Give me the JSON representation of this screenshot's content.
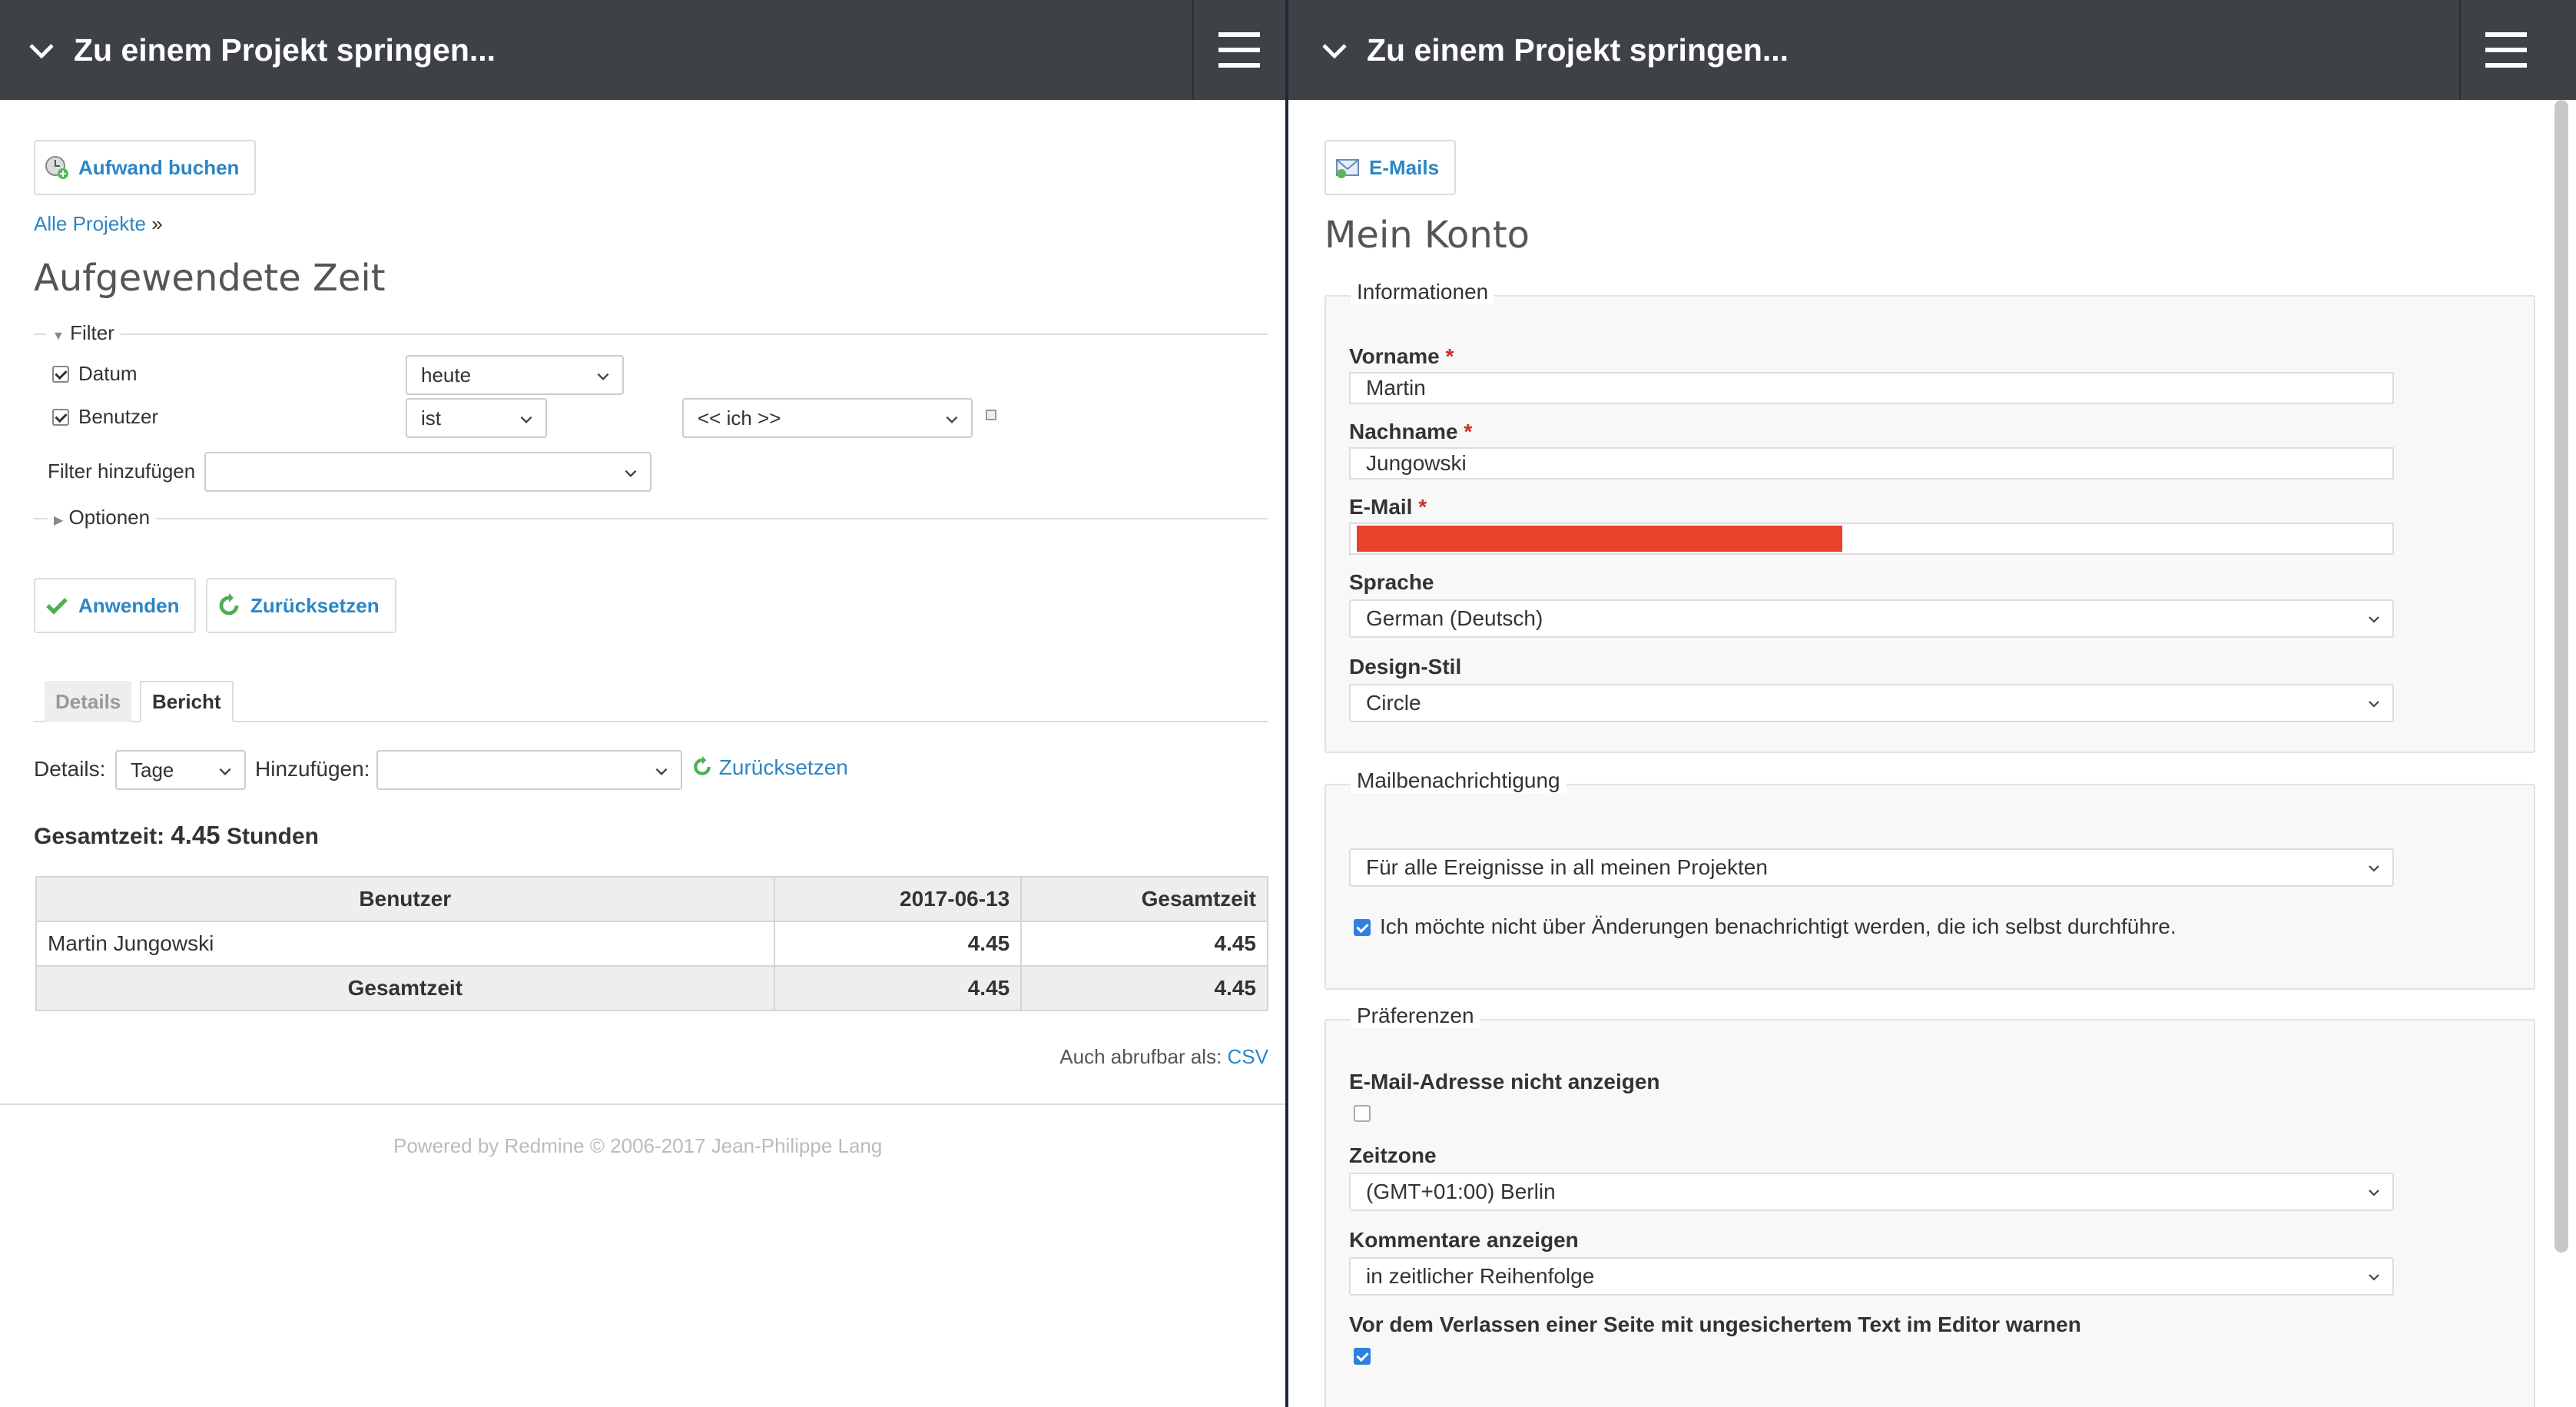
{
  "left": {
    "topbar": {
      "jump_label": "Zu einem Projekt springen..."
    },
    "book_time_button": "Aufwand buchen",
    "breadcrumb": {
      "link": "Alle Projekte",
      "sep": "»"
    },
    "title": "Aufgewendete Zeit",
    "filter": {
      "legend": "Filter",
      "rows": [
        {
          "label": "Datum",
          "operator": "heute",
          "value": ""
        },
        {
          "label": "Benutzer",
          "operator": "ist",
          "value": "<< ich >>"
        }
      ],
      "add_label": "Filter hinzufügen",
      "add_value": ""
    },
    "options_legend": "Optionen",
    "apply_button": "Anwenden",
    "reset_button": "Zurücksetzen",
    "tabs": [
      "Details",
      "Bericht"
    ],
    "details_label": "Details:",
    "details_value": "Tage",
    "add_label": "Hinzufügen:",
    "add_value": "",
    "reset_link": "Zurücksetzen",
    "total": {
      "label": "Gesamtzeit:",
      "value": "4.45",
      "unit": "Stunden"
    },
    "table": {
      "headers": [
        "Benutzer",
        "2017-06-13",
        "Gesamtzeit"
      ],
      "rows": [
        [
          "Martin Jungowski",
          "4.45",
          "4.45"
        ]
      ],
      "total_row": [
        "Gesamtzeit",
        "4.45",
        "4.45"
      ]
    },
    "export": {
      "label": "Auch abrufbar als:",
      "csv": "CSV"
    },
    "footer": "Powered by Redmine © 2006-2017 Jean-Philippe Lang"
  },
  "right": {
    "topbar": {
      "jump_label": "Zu einem Projekt springen..."
    },
    "emails_button": "E-Mails",
    "title": "Mein Konto",
    "info": {
      "legend": "Informationen",
      "firstname_label": "Vorname",
      "firstname": "Martin",
      "lastname_label": "Nachname",
      "lastname": "Jungowski",
      "email_label": "E-Mail",
      "email": "",
      "language_label": "Sprache",
      "language": "German (Deutsch)",
      "theme_label": "Design-Stil",
      "theme": "Circle",
      "required_mark": "*"
    },
    "mail": {
      "legend": "Mailbenachrichtigung",
      "option": "Für alle Ereignisse in all meinen Projekten",
      "no_self_label": "Ich möchte nicht über Änderungen benachrichtigt werden, die ich selbst durchführe."
    },
    "prefs": {
      "legend": "Präferenzen",
      "hide_mail_label": "E-Mail-Adresse nicht anzeigen",
      "timezone_label": "Zeitzone",
      "timezone": "(GMT+01:00) Berlin",
      "comments_label": "Kommentare anzeigen",
      "comments": "in zeitlicher Reihenfolge",
      "warn_label": "Vor dem Verlassen einer Seite mit ungesichertem Text im Editor warnen"
    }
  },
  "colors": {
    "topbar": "#3e4246",
    "link": "#2c86c5",
    "redaction": "#e8412c",
    "required": "#c9302c"
  }
}
